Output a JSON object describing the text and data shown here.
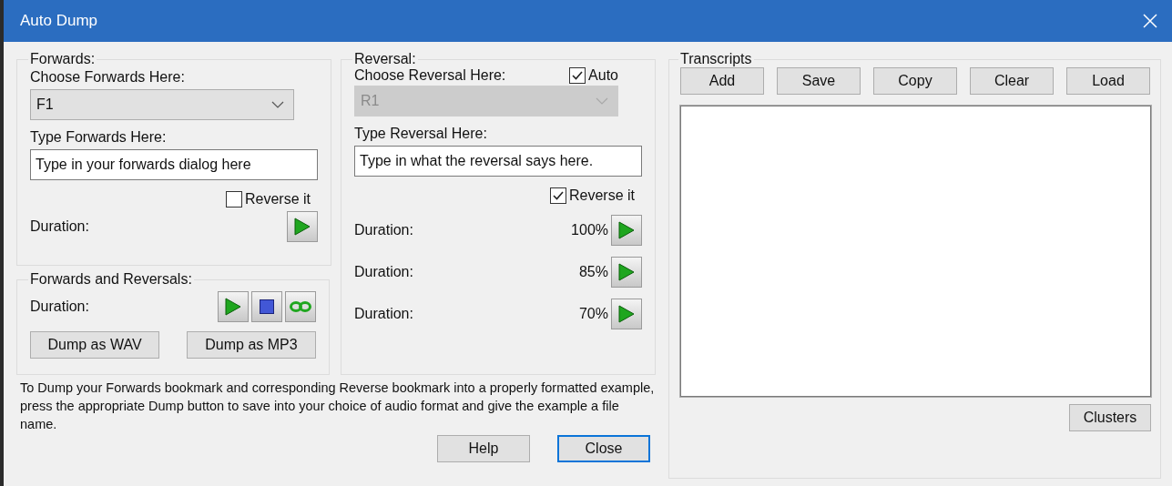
{
  "window": {
    "title": "Auto Dump"
  },
  "forwards": {
    "legend": "Forwards:",
    "choose_label": "Choose Forwards Here:",
    "dropdown": {
      "value": "F1",
      "disabled": false
    },
    "type_label": "Type Forwards Here:",
    "text_field": {
      "value": "Type in your forwards dialog here"
    },
    "reverse_it": {
      "label": "Reverse it",
      "checked": false
    },
    "duration_label": "Duration:",
    "controls": [
      {
        "kind": "play"
      }
    ]
  },
  "forwards_and_reversals": {
    "legend": "Forwards and Reversals:",
    "duration_label": "Duration:",
    "controls": [
      {
        "kind": "play"
      },
      {
        "kind": "stop"
      },
      {
        "kind": "loop"
      }
    ],
    "buttons": [
      "Dump as WAV",
      "Dump as MP3"
    ]
  },
  "reversal": {
    "legend": "Reversal:",
    "choose_label": "Choose Reversal Here:",
    "auto": {
      "label": "Auto",
      "checked": true
    },
    "dropdown": {
      "value": "R1",
      "disabled": true
    },
    "type_label": "Type Reversal Here:",
    "text_field": {
      "value": "Type in what the reversal says here."
    },
    "reverse_it": {
      "label": "Reverse it",
      "checked": true
    },
    "durations": [
      {
        "label": "Duration:",
        "percent": "100%"
      },
      {
        "label": "Duration:",
        "percent": "85%"
      },
      {
        "label": "Duration:",
        "percent": "70%"
      }
    ]
  },
  "note": "To Dump your Forwards bookmark and corresponding Reverse bookmark into a properly formatted example, press the appropriate Dump button to save into your choice of audio format and give the example a file name.",
  "buttons": [
    {
      "label": "Help",
      "focused": false
    },
    {
      "label": "Close",
      "focused": true
    }
  ],
  "transcripts": {
    "legend": "Transcripts",
    "buttons": [
      "Add",
      "Save",
      "Copy",
      "Clear",
      "Load"
    ],
    "clusters_button": "Clusters"
  }
}
